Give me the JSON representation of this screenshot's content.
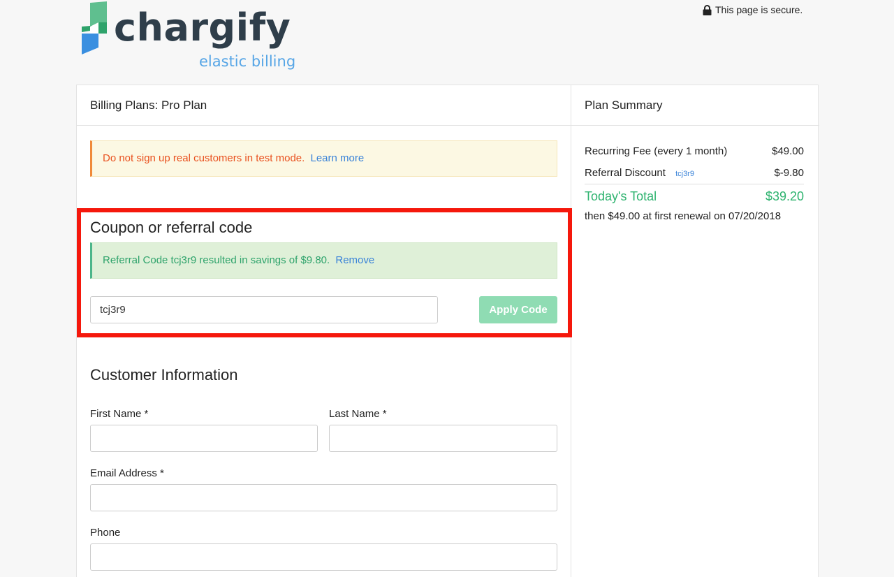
{
  "header": {
    "logo_word": "chargify",
    "logo_tagline": "elastic billing",
    "secure_text": "This page is secure."
  },
  "billing_panel": {
    "title": "Billing Plans: Pro Plan",
    "test_mode_warning": "Do not sign up real customers in test mode.",
    "learn_more_link": "Learn more"
  },
  "coupon": {
    "title": "Coupon or referral code",
    "success_message": "Referral Code tcj3r9 resulted in savings of $9.80.",
    "remove_link": "Remove",
    "code_value": "tcj3r9",
    "apply_button": "Apply Code"
  },
  "customer": {
    "title": "Customer Information",
    "first_name_label": "First Name *",
    "last_name_label": "Last Name *",
    "email_label": "Email Address *",
    "phone_label": "Phone"
  },
  "summary": {
    "title": "Plan Summary",
    "recurring_label": "Recurring Fee (every 1 month)",
    "recurring_value": "$49.00",
    "referral_label": "Referral Discount",
    "referral_code": "tcj3r9",
    "referral_value": "$-9.80",
    "total_label": "Today's Total",
    "total_value": "$39.20",
    "renewal_text": "then $49.00 at first renewal on 07/20/2018"
  },
  "colors": {
    "brand_dark": "#2f3e4a",
    "brand_blue": "#56a5e6",
    "success_green": "#2eb36f",
    "warning_orange": "#e9511f",
    "highlight_red": "#f5180c"
  }
}
